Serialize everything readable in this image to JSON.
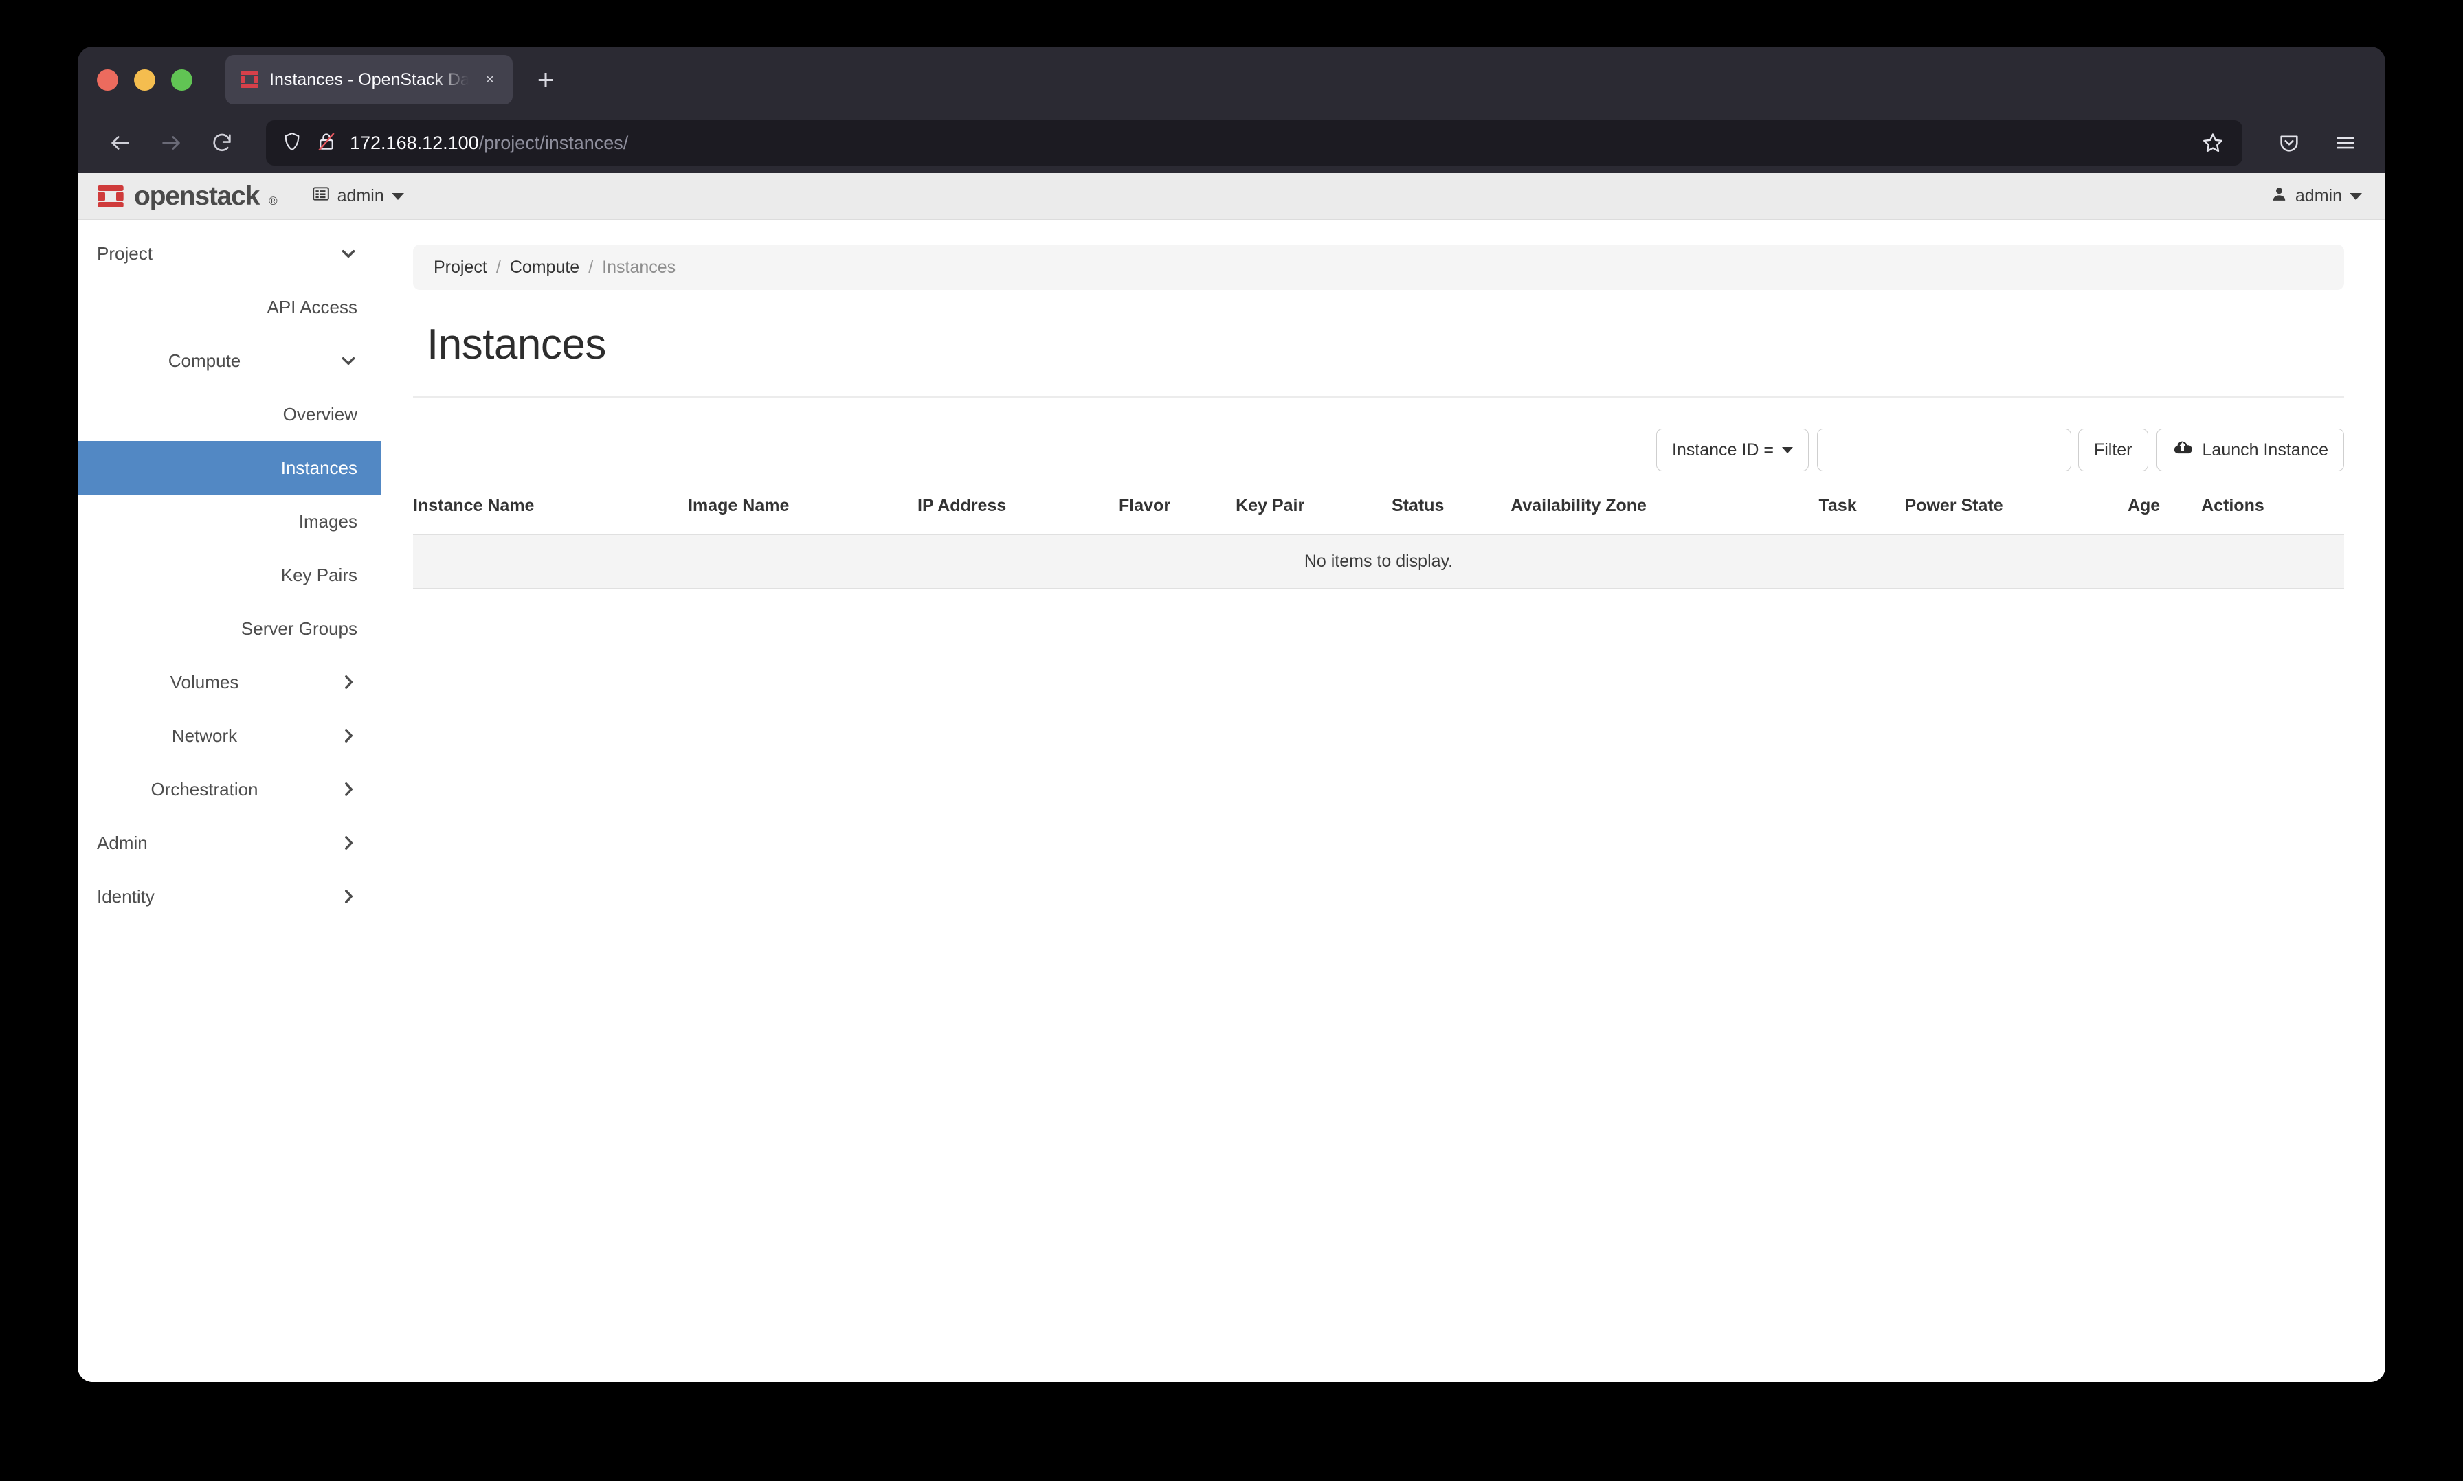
{
  "browser": {
    "tab": {
      "title": "Instances - OpenStack Dashboard",
      "favicon": "openstack-icon",
      "close": "✕"
    },
    "new_tab_label": "+",
    "nav": {
      "back": "←",
      "forward": "→",
      "reload": "↻"
    },
    "url": {
      "host": "172.168.12.100",
      "path": "/project/instances/",
      "shield_icon": "shield-icon",
      "lock_icon": "lock-broken-icon"
    },
    "bookmark_icon": "star-icon",
    "pocket_icon": "pocket-icon",
    "menu_icon": "hamburger-menu-icon"
  },
  "header": {
    "logo_word": "openstack",
    "logo_registered": "®",
    "project_selector": "admin",
    "project_icon": "list-icon",
    "user": "admin",
    "user_icon": "user-icon"
  },
  "sidebar": {
    "items": [
      {
        "label": "Project",
        "level": 0,
        "toggle": "chevron-down",
        "active": false
      },
      {
        "label": "API Access",
        "level": 2,
        "toggle": "",
        "active": false
      },
      {
        "label": "Compute",
        "level": 1,
        "toggle": "chevron-down",
        "active": false
      },
      {
        "label": "Overview",
        "level": 2,
        "toggle": "",
        "active": false
      },
      {
        "label": "Instances",
        "level": 2,
        "toggle": "",
        "active": true
      },
      {
        "label": "Images",
        "level": 2,
        "toggle": "",
        "active": false
      },
      {
        "label": "Key Pairs",
        "level": 2,
        "toggle": "",
        "active": false
      },
      {
        "label": "Server Groups",
        "level": 2,
        "toggle": "",
        "active": false
      },
      {
        "label": "Volumes",
        "level": 1,
        "toggle": "chevron-right",
        "active": false
      },
      {
        "label": "Network",
        "level": 1,
        "toggle": "chevron-right",
        "active": false
      },
      {
        "label": "Orchestration",
        "level": 1,
        "toggle": "chevron-right",
        "active": false
      },
      {
        "label": "Admin",
        "level": 0,
        "toggle": "chevron-right",
        "active": false
      },
      {
        "label": "Identity",
        "level": 0,
        "toggle": "chevron-right",
        "active": false
      }
    ]
  },
  "breadcrumb": {
    "items": [
      "Project",
      "Compute",
      "Instances"
    ],
    "separator": "/"
  },
  "page": {
    "title": "Instances"
  },
  "toolbar": {
    "filter_field": "Instance ID =",
    "filter_value": "",
    "filter_placeholder": "",
    "filter_button": "Filter",
    "launch_button": "Launch Instance",
    "launch_icon": "cloud-upload-icon"
  },
  "table": {
    "columns": [
      "Instance Name",
      "Image Name",
      "IP Address",
      "Flavor",
      "Key Pair",
      "Status",
      "Availability Zone",
      "Task",
      "Power State",
      "Age",
      "Actions"
    ],
    "rows": [],
    "empty_message": "No items to display."
  },
  "colors": {
    "accent_blue": "#5288c4",
    "openstack_red": "#d33b3b",
    "chrome_dark": "#2b2a33",
    "urlbar_dark": "#1c1b22",
    "header_gray": "#ebebeb"
  }
}
